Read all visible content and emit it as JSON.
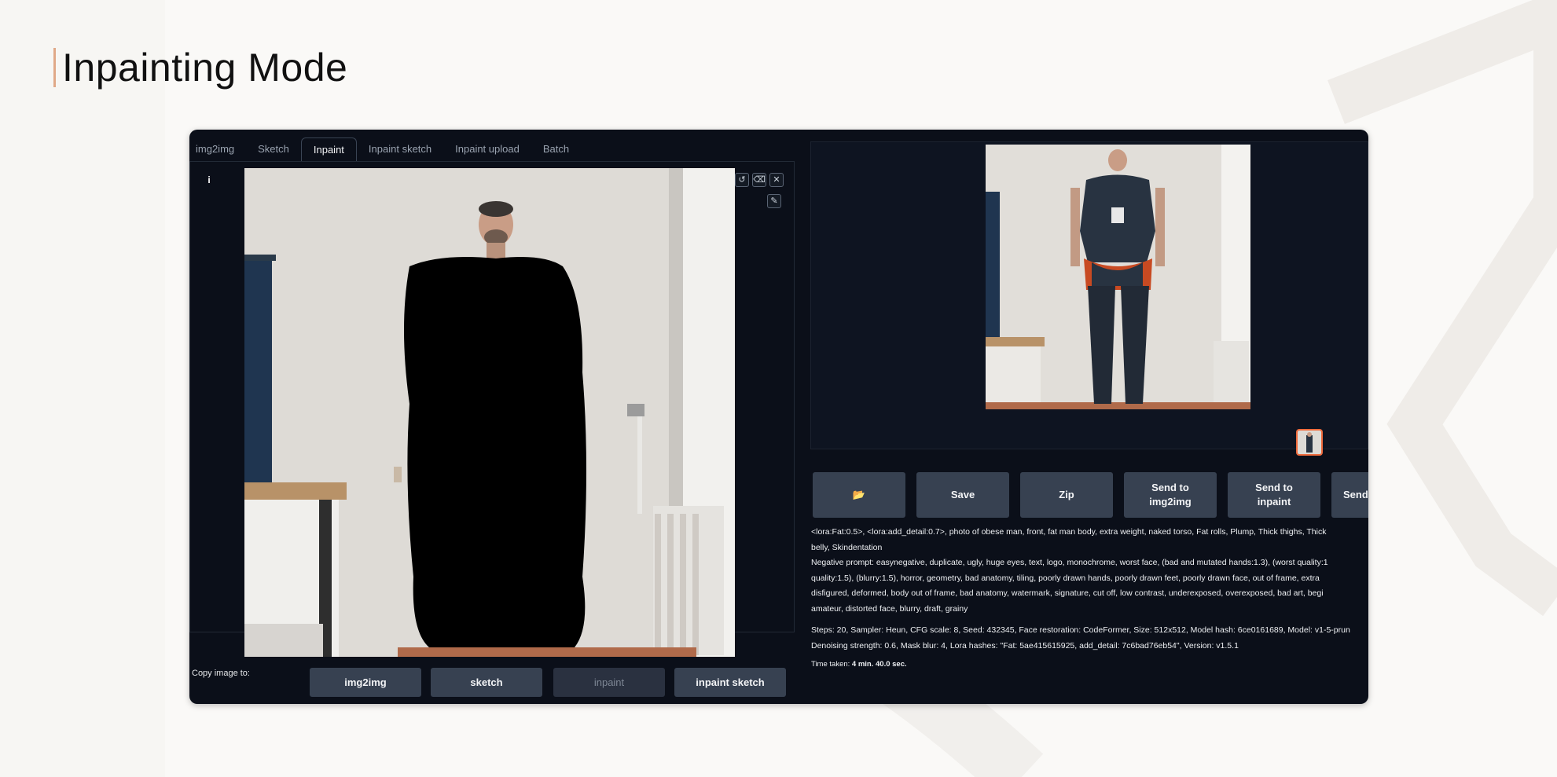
{
  "slide": {
    "title": "Inpainting Mode"
  },
  "tabs": [
    {
      "label": "img2img",
      "active": false
    },
    {
      "label": "Sketch",
      "active": false
    },
    {
      "label": "Inpaint",
      "active": true
    },
    {
      "label": "Inpaint sketch",
      "active": false
    },
    {
      "label": "Inpaint upload",
      "active": false
    },
    {
      "label": "Batch",
      "active": false
    }
  ],
  "canvas": {
    "info_icon": "i",
    "tools": [
      "undo-icon",
      "eraser-icon",
      "close-icon"
    ],
    "brush_icon": "brush-icon"
  },
  "copy_to": {
    "label": "Copy image to:",
    "buttons": [
      {
        "label": "img2img",
        "enabled": true
      },
      {
        "label": "sketch",
        "enabled": true
      },
      {
        "label": "inpaint",
        "enabled": false
      },
      {
        "label": "inpaint sketch",
        "enabled": true
      }
    ]
  },
  "actions": {
    "folder_icon": "folder-icon",
    "save": "Save",
    "zip": "Zip",
    "send_img2img_line1": "Send to",
    "send_img2img_line2": "img2img",
    "send_inpaint_line1": "Send to",
    "send_inpaint_line2": "inpaint",
    "send_more": "Send"
  },
  "generation_info": {
    "prompt_line1": "<lora:Fat:0.5>, <lora:add_detail:0.7>, photo of obese man, front, fat man body, extra weight, naked torso, Fat rolls, Plump, Thick thighs, Thick",
    "prompt_line2": "belly, Skindentation",
    "negative_line1": "Negative prompt: easynegative, duplicate, ugly, huge eyes, text, logo, monochrome, worst face, (bad and mutated hands:1.3), (worst quality:1",
    "negative_line2": "quality:1.5), (blurry:1.5), horror, geometry, bad anatomy, tiling, poorly drawn hands, poorly drawn feet, poorly drawn face, out of frame, extra",
    "negative_line3": "disfigured, deformed, body out of frame, bad anatomy, watermark, signature, cut off, low contrast, underexposed, overexposed, bad art, begi",
    "negative_line4": "amateur, distorted face, blurry, draft, grainy",
    "steps_line1": "Steps: 20, Sampler: Heun, CFG scale: 8, Seed: 432345, Face restoration: CodeFormer, Size: 512x512, Model hash: 6ce0161689, Model: v1-5-prun",
    "steps_line2": "Denoising strength: 0.6, Mask blur: 4, Lora hashes: \"Fat: 5ae415615925, add_detail: 7c6bad76eb54\", Version: v1.5.1",
    "time_label": "Time taken:",
    "time_value": "4 min. 40.0 sec."
  }
}
